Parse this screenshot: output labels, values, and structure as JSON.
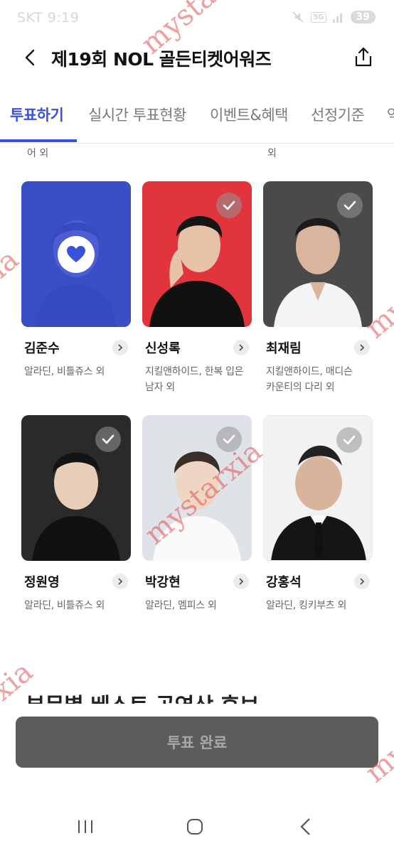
{
  "status_bar": {
    "time": "SKT 9:19",
    "network": "5G",
    "battery": "39"
  },
  "header": {
    "title": "제19회 NOL 골든티켓어워즈",
    "back_icon": "chevron-left-icon",
    "share_icon": "share-icon"
  },
  "tabs": [
    {
      "label": "투표하기",
      "active": true
    },
    {
      "label": "실시간 투표현황",
      "active": false
    },
    {
      "label": "이벤트&혜택",
      "active": false
    },
    {
      "label": "선정기준",
      "active": false
    },
    {
      "label": "역",
      "active": false
    }
  ],
  "partial_row": {
    "left_sub": "어 외",
    "right_sub": "외"
  },
  "candidates": [
    {
      "name": "김준수",
      "works": "알라딘, 비틀쥬스 외",
      "selected": true,
      "bg": "#2f4bd6"
    },
    {
      "name": "신성록",
      "works": "지킬앤하이드, 한복 입은 남자 외",
      "selected": false,
      "bg": "#e2343c"
    },
    {
      "name": "최재림",
      "works": "지킬앤하이드, 매디슨 카운티의 다리 외",
      "selected": false,
      "bg": "#4a4a4a"
    },
    {
      "name": "정원영",
      "works": "알라딘, 비틀쥬스 외",
      "selected": false,
      "bg": "#2a2a2a"
    },
    {
      "name": "박강현",
      "works": "알라딘, 멤피스 외",
      "selected": false,
      "bg": "#dfe3e8"
    },
    {
      "name": "강홍석",
      "works": "알라딘, 킹키부츠 외",
      "selected": false,
      "bg": "#f2f2f2"
    }
  ],
  "section": {
    "title": "부문별 베스트 공연상 후보"
  },
  "vote_button": {
    "label": "투표 완료"
  },
  "colors": {
    "accent": "#3a51d9",
    "button_disabled": "#5c5c5c"
  },
  "watermark": "mystarxia"
}
